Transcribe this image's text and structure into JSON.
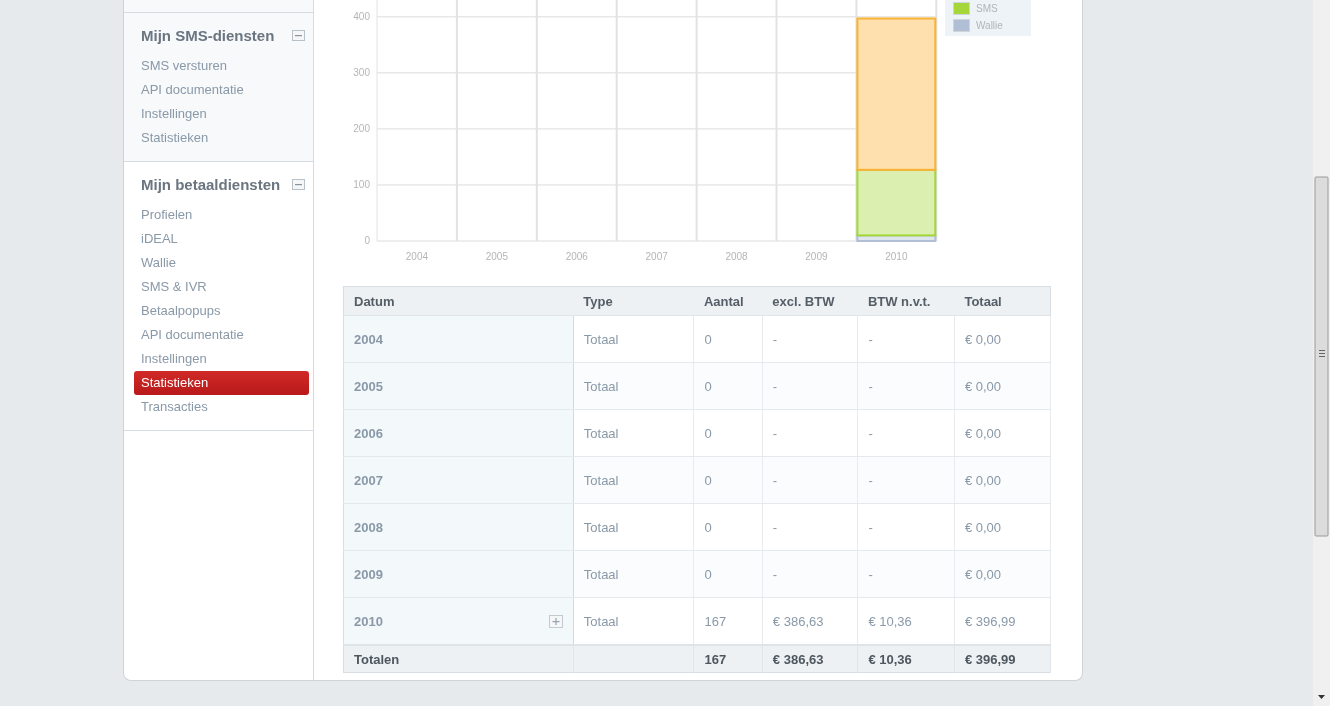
{
  "sidebar": {
    "sections": [
      {
        "title": "Mijn SMS-diensten",
        "expanded": true,
        "items": [
          {
            "label": "SMS versturen",
            "selected": false
          },
          {
            "label": "API documentatie",
            "selected": false
          },
          {
            "label": "Instellingen",
            "selected": false
          },
          {
            "label": "Statistieken",
            "selected": false
          }
        ]
      },
      {
        "title": "Mijn betaaldiensten",
        "expanded": true,
        "items": [
          {
            "label": "Profielen",
            "selected": false
          },
          {
            "label": "iDEAL",
            "selected": false
          },
          {
            "label": "Wallie",
            "selected": false
          },
          {
            "label": "SMS & IVR",
            "selected": false
          },
          {
            "label": "Betaalpopups",
            "selected": false
          },
          {
            "label": "API documentatie",
            "selected": false
          },
          {
            "label": "Instellingen",
            "selected": false
          },
          {
            "label": "Statistieken",
            "selected": true
          },
          {
            "label": "Transacties",
            "selected": false
          }
        ]
      }
    ]
  },
  "chart": {
    "chart_data": {
      "type": "bar",
      "stacked": true,
      "categories": [
        "2004",
        "2005",
        "2006",
        "2007",
        "2008",
        "2009",
        "2010"
      ],
      "yticks": [
        0,
        100,
        200,
        300,
        400
      ],
      "ylim": [
        0,
        430
      ],
      "grid": true,
      "series": [
        {
          "name": "Wallie",
          "color": "#b0bfd6",
          "values": [
            0,
            0,
            0,
            0,
            0,
            0,
            10
          ]
        },
        {
          "name": "SMS",
          "color": "#a5d63a",
          "values": [
            0,
            0,
            0,
            0,
            0,
            0,
            117
          ]
        },
        {
          "color": "#f9b233",
          "values": [
            0,
            0,
            0,
            0,
            0,
            0,
            270
          ]
        }
      ]
    }
  },
  "table": {
    "columns": [
      "Datum",
      "Type",
      "Aantal",
      "excl. BTW",
      "BTW n.v.t.",
      "Totaal"
    ],
    "rows": [
      {
        "cells": [
          "2004",
          "Totaal",
          "0",
          "-",
          "-",
          "€ 0,00"
        ],
        "expandable": false
      },
      {
        "cells": [
          "2005",
          "Totaal",
          "0",
          "-",
          "-",
          "€ 0,00"
        ],
        "expandable": false
      },
      {
        "cells": [
          "2006",
          "Totaal",
          "0",
          "-",
          "-",
          "€ 0,00"
        ],
        "expandable": false
      },
      {
        "cells": [
          "2007",
          "Totaal",
          "0",
          "-",
          "-",
          "€ 0,00"
        ],
        "expandable": false
      },
      {
        "cells": [
          "2008",
          "Totaal",
          "0",
          "-",
          "-",
          "€ 0,00"
        ],
        "expandable": false
      },
      {
        "cells": [
          "2009",
          "Totaal",
          "0",
          "-",
          "-",
          "€ 0,00"
        ],
        "expandable": false
      },
      {
        "cells": [
          "2010",
          "Totaal",
          "167",
          "€ 386,63",
          "€ 10,36",
          "€ 396,99"
        ],
        "expandable": true
      }
    ],
    "totals": {
      "label": "Totalen",
      "cells": [
        "167",
        "€ 386,63",
        "€ 10,36",
        "€ 396,99"
      ]
    }
  }
}
